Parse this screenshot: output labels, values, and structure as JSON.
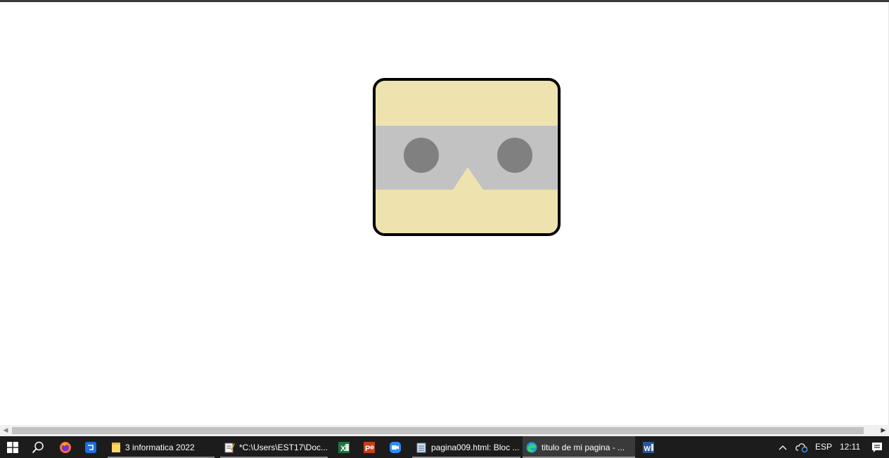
{
  "canvas": {
    "colors": {
      "face": "#EEE2AE",
      "band": "#C2C2C2",
      "eyes": "#808080",
      "border": "#000000"
    }
  },
  "taskbar": {
    "start_icon": "windows-logo-icon",
    "search_icon": "search-icon",
    "pinned": [
      {
        "icon": "firefox-icon"
      },
      {
        "icon": "teams-app-icon"
      }
    ],
    "apps": [
      {
        "icon": "folder-icon",
        "label": "3 informatica 2022"
      },
      {
        "icon": "notepad-icon",
        "label": "*C:\\Users\\EST17\\Doc..."
      },
      {
        "icon": "excel-icon",
        "label": ""
      },
      {
        "icon": "powerpoint-icon",
        "label": ""
      },
      {
        "icon": "zoom-icon",
        "label": ""
      },
      {
        "icon": "notepad-icon",
        "label": "pagina009.html: Bloc ..."
      },
      {
        "icon": "edge-icon",
        "label": "titulo de mi pagina - ..."
      },
      {
        "icon": "word-icon",
        "label": ""
      }
    ],
    "tray": {
      "language": "ESP",
      "time": "12:11"
    }
  }
}
